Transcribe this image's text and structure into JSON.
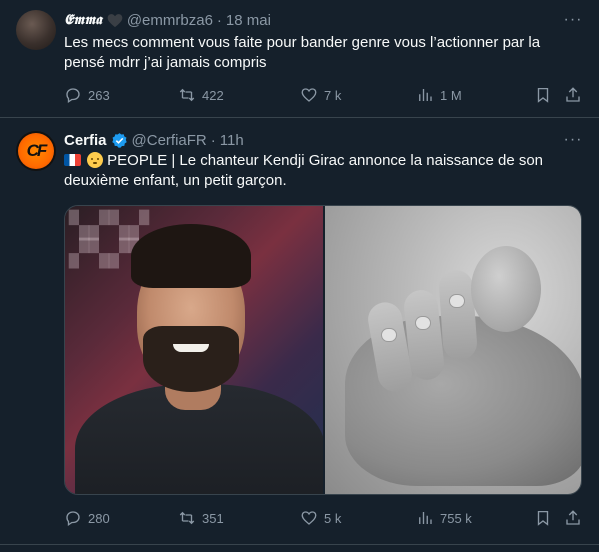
{
  "tweets": [
    {
      "display_name": "𝕰𝖒𝖒𝖆",
      "handle": "@emmrbza6",
      "separator": "·",
      "time": "18 mai",
      "more": "···",
      "text": "Les mecs comment vous faite pour bander genre vous l’actionner par la pensé mdrr j’ai jamais compris",
      "stats": {
        "replies": "263",
        "retweets": "422",
        "likes": "7 k",
        "views": "1 M"
      }
    },
    {
      "display_name": "Cerfia",
      "handle": "@CerfiaFR",
      "separator": "·",
      "time": "11h",
      "more": "···",
      "avatar_text": "CF",
      "text": "PEOPLE | Le chanteur Kendji Girac annonce la naissance de son deuxième enfant, un petit garçon.",
      "stats": {
        "replies": "280",
        "retweets": "351",
        "likes": "5 k",
        "views": "755 k"
      }
    }
  ],
  "colors": {
    "background": "#15202b",
    "text_primary": "#f7f9f9",
    "text_muted": "#8b98a5",
    "divider": "#38444d",
    "verified": "#1d9bf0",
    "cerfia_orange": "#ff6a00"
  },
  "icons": [
    "reply-icon",
    "retweet-icon",
    "like-icon",
    "views-icon",
    "bookmark-icon",
    "share-icon",
    "verified-icon",
    "heart-badge-icon",
    "more-icon"
  ]
}
